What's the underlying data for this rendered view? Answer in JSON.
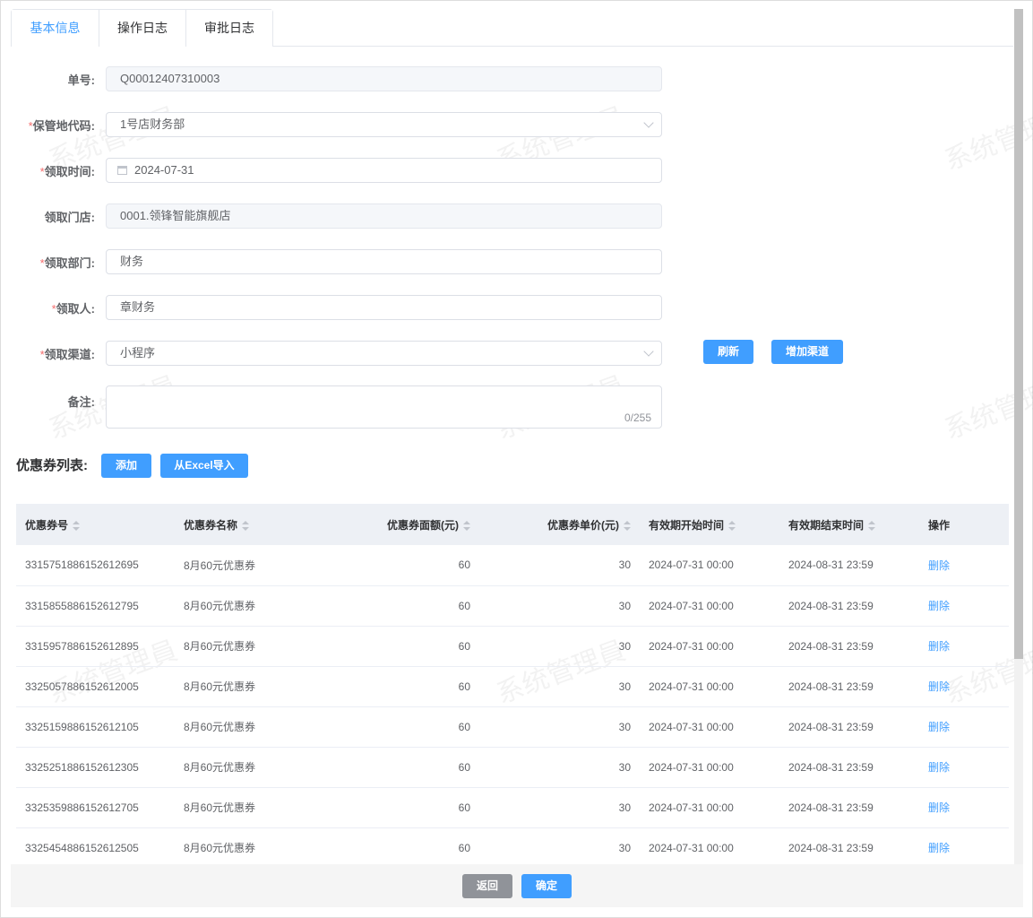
{
  "tabs": [
    "基本信息",
    "操作日志",
    "审批日志"
  ],
  "form": {
    "order_no": {
      "label": "单号:",
      "value": "Q00012407310003"
    },
    "storage": {
      "label": "保管地代码:",
      "value": "1号店财务部"
    },
    "time": {
      "label": "领取时间:",
      "value": "2024-07-31"
    },
    "store": {
      "label": "领取门店:",
      "value": "0001.领锋智能旗舰店"
    },
    "dept": {
      "label": "领取部门:",
      "value": "财务"
    },
    "person": {
      "label": "领取人:",
      "value": "章财务"
    },
    "channel": {
      "label": "领取渠道:",
      "value": "小程序"
    },
    "remark": {
      "label": "备注:",
      "counter": "0/255"
    },
    "required_mark": "*"
  },
  "buttons": {
    "refresh": "刷新",
    "add_channel": "增加渠道",
    "add": "添加",
    "import": "从Excel导入",
    "back": "返回",
    "confirm": "确定"
  },
  "section_title": "优惠券列表:",
  "table": {
    "headers": [
      "优惠券号",
      "优惠券名称",
      "优惠券面额(元)",
      "优惠券单价(元)",
      "有效期开始时间",
      "有效期结束时间",
      "操作"
    ],
    "rows": [
      [
        "3315751886152612695",
        "8月60元优惠券",
        "60",
        "30",
        "2024-07-31 00:00",
        "2024-08-31 23:59",
        "删除"
      ],
      [
        "3315855886152612795",
        "8月60元优惠券",
        "60",
        "30",
        "2024-07-31 00:00",
        "2024-08-31 23:59",
        "删除"
      ],
      [
        "3315957886152612895",
        "8月60元优惠券",
        "60",
        "30",
        "2024-07-31 00:00",
        "2024-08-31 23:59",
        "删除"
      ],
      [
        "3325057886152612005",
        "8月60元优惠券",
        "60",
        "30",
        "2024-07-31 00:00",
        "2024-08-31 23:59",
        "删除"
      ],
      [
        "3325159886152612105",
        "8月60元优惠券",
        "60",
        "30",
        "2024-07-31 00:00",
        "2024-08-31 23:59",
        "删除"
      ],
      [
        "3325251886152612305",
        "8月60元优惠券",
        "60",
        "30",
        "2024-07-31 00:00",
        "2024-08-31 23:59",
        "删除"
      ],
      [
        "3325359886152612705",
        "8月60元优惠券",
        "60",
        "30",
        "2024-07-31 00:00",
        "2024-08-31 23:59",
        "删除"
      ],
      [
        "3325454886152612505",
        "8月60元优惠券",
        "60",
        "30",
        "2024-07-31 00:00",
        "2024-08-31 23:59",
        "删除"
      ]
    ]
  },
  "watermark": "系统管理員"
}
